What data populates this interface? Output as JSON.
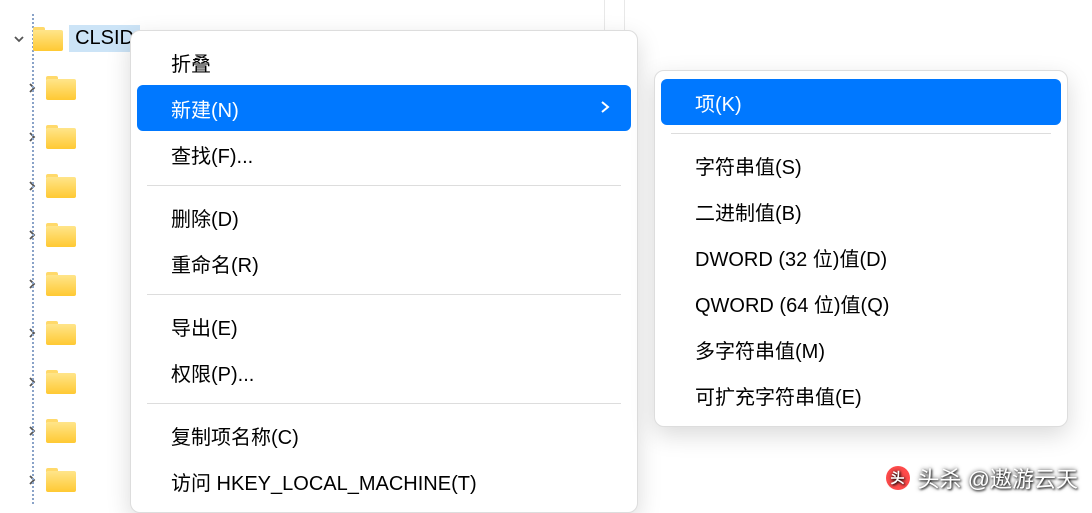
{
  "tree": {
    "selected_label": "CLSID",
    "child_count": 10
  },
  "menu1": {
    "items": [
      {
        "label": "折叠",
        "highlighted": false,
        "has_arrow": false
      },
      {
        "label": "新建(N)",
        "highlighted": true,
        "has_arrow": true
      }
    ],
    "group2": [
      {
        "label": "查找(F)..."
      }
    ],
    "group3": [
      {
        "label": "删除(D)"
      },
      {
        "label": "重命名(R)"
      }
    ],
    "group4": [
      {
        "label": "导出(E)"
      },
      {
        "label": "权限(P)..."
      }
    ],
    "group5": [
      {
        "label": "复制项名称(C)"
      },
      {
        "label": "访问 HKEY_LOCAL_MACHINE(T)"
      }
    ]
  },
  "menu2": {
    "highlighted": {
      "label": "项(K)"
    },
    "items": [
      {
        "label": "字符串值(S)"
      },
      {
        "label": "二进制值(B)"
      },
      {
        "label": "DWORD (32 位)值(D)"
      },
      {
        "label": "QWORD (64 位)值(Q)"
      },
      {
        "label": "多字符串值(M)"
      },
      {
        "label": "可扩充字符串值(E)"
      }
    ]
  },
  "watermark": {
    "text": "头杀 @遨游云天"
  }
}
